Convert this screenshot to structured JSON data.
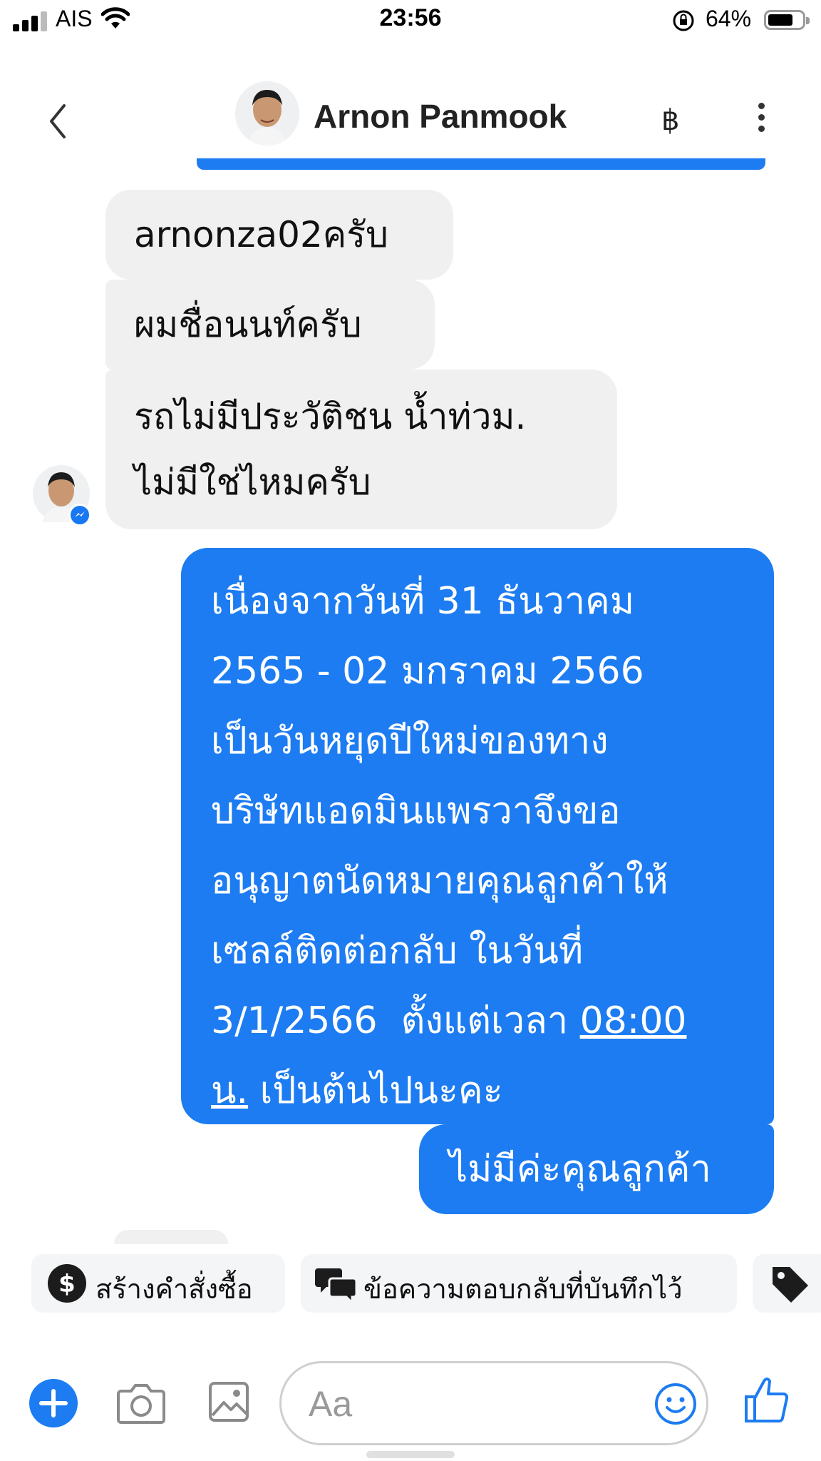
{
  "status_bar": {
    "carrier": "AIS",
    "time": "23:56",
    "battery": "64%"
  },
  "header": {
    "contact_name": "Arnon Panmook",
    "currency_symbol": "฿"
  },
  "messages": {
    "incoming": [
      {
        "lines": [
          "arnonza02ครับ"
        ]
      },
      {
        "lines": [
          "ผมชื่อนนท์ครับ"
        ]
      },
      {
        "lines": [
          "รถไม่มีประวัติชน น้ำท่วม.",
          "ไม่มีใช่ไหมครับ"
        ]
      }
    ],
    "outgoing_1": {
      "lines": [
        "เนื่องจากวันที่ 31 ธันวาคม",
        "2565 - 02 มกราคม 2566",
        "เป็นวันหยุดปีใหม่ของทาง",
        "บริษัทแอดมินแพรวาจึงขอ",
        "อนุญาตนัดหมายคุณลูกค้าให้",
        "เซลล์ติดต่อกลับ ในวันที่"
      ],
      "line7_prefix": "3/1/2566  ตั้งแต่เวลา ",
      "time_link_a": "08:00",
      "time_link_b": "น.",
      "line8_suffix": " เป็นต้นไปนะคะ"
    },
    "outgoing_2": {
      "text": "ไม่มีค่ะคุณลูกค้า"
    }
  },
  "quick_replies": [
    {
      "label": "สร้างคำสั่งซื้อ",
      "icon": "dollar-circle-icon"
    },
    {
      "label": "ข้อความตอบกลับที่บันทึกไว้",
      "icon": "chat-bubbles-icon"
    },
    {
      "label": "",
      "icon": "tag-icon"
    }
  ],
  "composer": {
    "placeholder": "Aa"
  },
  "colors": {
    "accent": "#1d7cf2",
    "incoming_bubble": "#f0f0f0"
  }
}
